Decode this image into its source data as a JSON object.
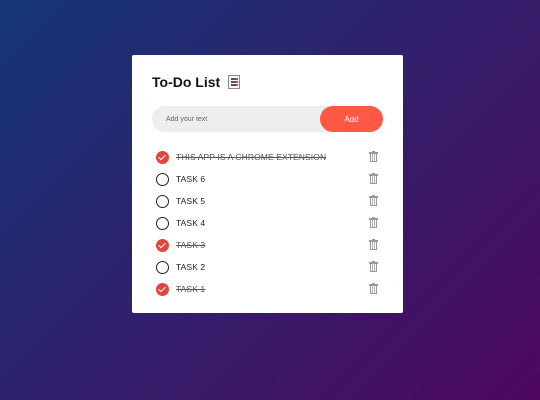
{
  "app": {
    "title": "To-Do List",
    "title_icon": "notepad-icon"
  },
  "input": {
    "placeholder": "Add your text",
    "value": ""
  },
  "add_button": {
    "label": "Add"
  },
  "colors": {
    "accent": "#ff5945",
    "check": "#e0463a",
    "background_start": "#153677",
    "background_end": "#4e085f"
  },
  "tasks": [
    {
      "text": "THIS APP IS A CHROME EXTENSION",
      "checked": true
    },
    {
      "text": "TASK 6",
      "checked": false
    },
    {
      "text": "TASK 5",
      "checked": false
    },
    {
      "text": "TASK 4",
      "checked": false
    },
    {
      "text": "TASK 3",
      "checked": true
    },
    {
      "text": "TASK 2",
      "checked": false
    },
    {
      "text": "TASK 1",
      "checked": true
    }
  ]
}
